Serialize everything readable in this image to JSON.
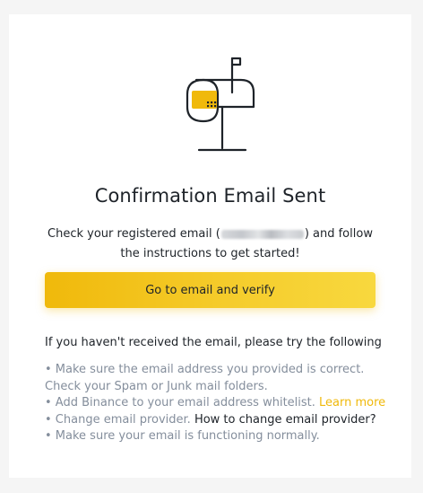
{
  "title": "Confirmation Email Sent",
  "description": {
    "line1_before": "Check your registered email (",
    "line1_after": ") and follow",
    "line2": "the instructions to get started!"
  },
  "cta_label": "Go to email and verify",
  "hint_title": "If you haven't received the email, please try the following",
  "tips": {
    "tip1_line1": "• Make sure the email address you provided is correct.",
    "tip1_line2": "Check your Spam or Junk mail folders.",
    "tip2_text": "• Add Binance to your email address whitelist. ",
    "tip2_link": "Learn more",
    "tip3_text": "• Change email provider. ",
    "tip3_link": "How to change email provider?",
    "tip4": "• Make sure your email is functioning normally."
  },
  "icons": {
    "illustration": "mailbox-icon"
  },
  "colors": {
    "accent": "#f0b90b",
    "text_primary": "#1e2329",
    "text_secondary": "#848e9c",
    "background": "#f5f5f5"
  }
}
